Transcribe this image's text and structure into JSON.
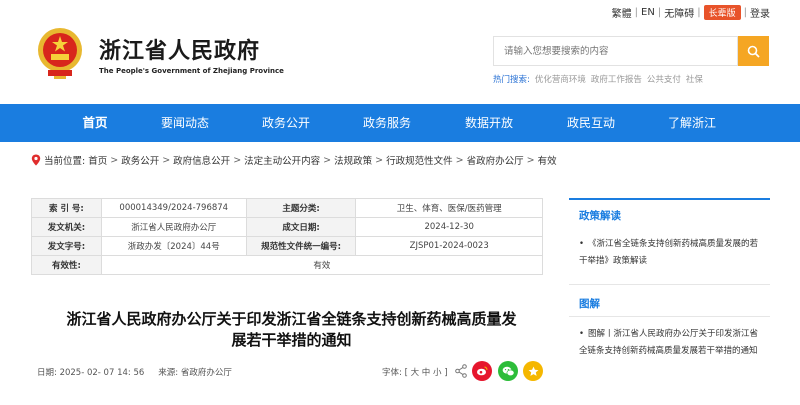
{
  "topbar": {
    "links": [
      "繁體",
      "EN",
      "无障碍"
    ],
    "elder": "长辈版",
    "login": "登录"
  },
  "header": {
    "title": "浙江省人民政府",
    "subtitle": "The People's Government of Zhejiang Province",
    "search_placeholder": "请输入您想要搜索的内容",
    "hot_label": "热门搜索:",
    "hot_terms": [
      "优化营商环境",
      "政府工作报告",
      "公共支付",
      "社保"
    ]
  },
  "nav": {
    "items": [
      "首页",
      "要闻动态",
      "政务公开",
      "政务服务",
      "数据开放",
      "政民互动",
      "了解浙江"
    ]
  },
  "breadcrumb": {
    "label": "当前位置:",
    "items": [
      "首页",
      "政务公开",
      "政府信息公开",
      "法定主动公开内容",
      "法规政策",
      "行政规范性文件",
      "省政府办公厅",
      "有效"
    ]
  },
  "meta": {
    "rows": [
      {
        "k1": "索 引 号:",
        "v1": "000014349/2024-796874",
        "k2": "主题分类:",
        "v2": "卫生、体育、医保/医药管理"
      },
      {
        "k1": "发文机关:",
        "v1": "浙江省人民政府办公厅",
        "k2": "成文日期:",
        "v2": "2024-12-30"
      },
      {
        "k1": "发文字号:",
        "v1": "浙政办发〔2024〕44号",
        "k2": "规范性文件统一编号:",
        "v2": "ZJSP01-2024-0023"
      }
    ],
    "validity_key": "有效性:",
    "validity_value": "有效"
  },
  "article": {
    "title_line1": "浙江省人民政府办公厅关于印发浙江省全链条支持创新药械高质量发",
    "title_line2": "展若干举措的通知",
    "date": "日期:  2025- 02- 07 14: 56",
    "source": "来源:  省政府办公厅",
    "font_label": "字体: [ 大 中 小 ]"
  },
  "sidebar": {
    "section1": {
      "title": "政策解读",
      "text": "《浙江省全链条支持创新药械高质量发展的若干举措》政策解读"
    },
    "section2": {
      "title": "图解",
      "text": "图解丨浙江省人民政府办公厅关于印发浙江省全链条支持创新药械高质量发展若干举措的通知"
    }
  },
  "colors": {
    "nav": "#1a7de0",
    "search_button": "#f5a623",
    "elder": "#e8532a"
  }
}
